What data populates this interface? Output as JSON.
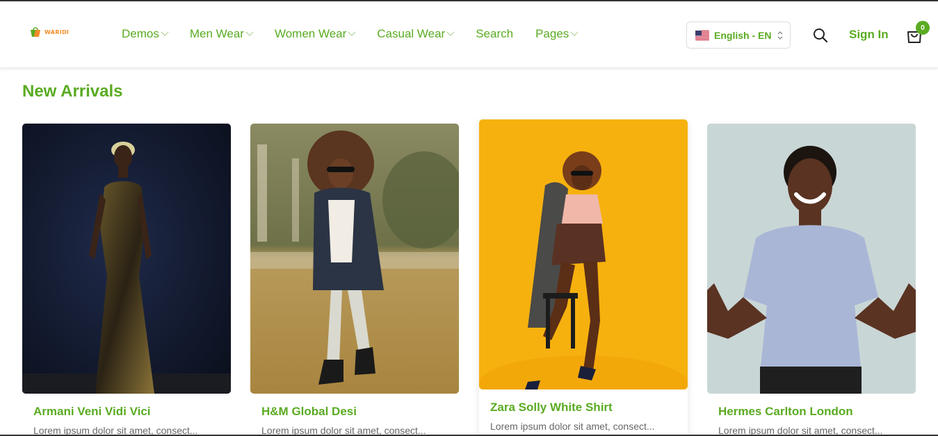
{
  "brand": {
    "name": "WARIDI"
  },
  "nav": {
    "items": [
      {
        "label": "Demos",
        "has_dropdown": true
      },
      {
        "label": "Men Wear",
        "has_dropdown": true
      },
      {
        "label": "Women Wear",
        "has_dropdown": true
      },
      {
        "label": "Casual Wear",
        "has_dropdown": true
      },
      {
        "label": "Search",
        "has_dropdown": false
      },
      {
        "label": "Pages",
        "has_dropdown": true
      }
    ]
  },
  "language": {
    "label": "English - EN",
    "flag": "us-flag-icon"
  },
  "header_actions": {
    "search_icon": "search-icon",
    "signin_label": "Sign In",
    "cart_icon": "cart-icon",
    "cart_count": "0"
  },
  "section": {
    "title": "New Arrivals"
  },
  "products": [
    {
      "title": "Armani Veni Vidi Vici",
      "description": "Lorem ipsum dolor sit amet, consect..."
    },
    {
      "title": "H&M Global Desi",
      "description": "Lorem ipsum dolor sit amet, consect..."
    },
    {
      "title": "Zara Solly White Shirt",
      "description": "Lorem ipsum dolor sit amet, consect..."
    },
    {
      "title": "Hermes Carlton London",
      "description": "Lorem ipsum dolor sit amet, consect..."
    }
  ],
  "colors": {
    "accent": "#5aab22",
    "logo": "#f28c28"
  }
}
